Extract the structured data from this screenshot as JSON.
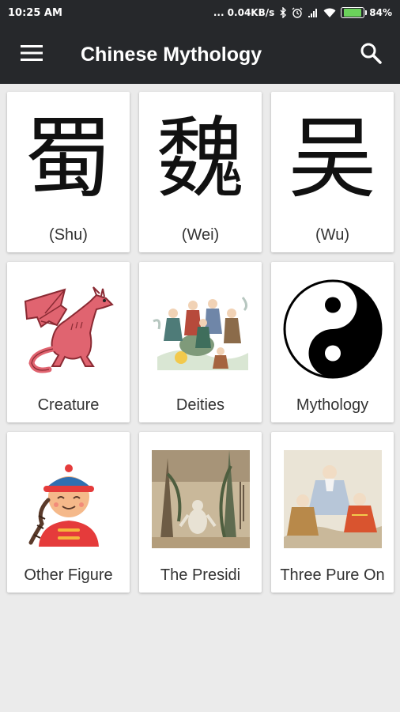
{
  "status_bar": {
    "time": "10:25 AM",
    "network_speed": "... 0.04KB/s",
    "battery_percent": "84%",
    "battery_level": 0.84,
    "icons": [
      "bluetooth-icon",
      "alarm-icon",
      "signal-icon",
      "wifi-icon",
      "battery-icon"
    ]
  },
  "app_bar": {
    "title": "Chinese Mythology",
    "menu_icon": "hamburger-menu-icon",
    "search_icon": "search-icon"
  },
  "cards": [
    {
      "label": "(Shu)",
      "glyph": "蜀"
    },
    {
      "label": "(Wei)",
      "glyph": "魏"
    },
    {
      "label": "(Wu)",
      "glyph": "吴"
    },
    {
      "label": "Creature",
      "image": "red-dragon-illustration"
    },
    {
      "label": "Deities",
      "image": "deities-group-painting"
    },
    {
      "label": "Mythology",
      "image": "yin-yang-symbol"
    },
    {
      "label": "Other Figure",
      "image": "chinese-figure-avatar"
    },
    {
      "label": "The Presidi",
      "image": "presiding-painting"
    },
    {
      "label": "Three Pure On",
      "image": "three-pure-ones-painting"
    }
  ],
  "colors": {
    "app_bar": "#26282b",
    "background": "#ebebeb",
    "card": "#ffffff"
  }
}
